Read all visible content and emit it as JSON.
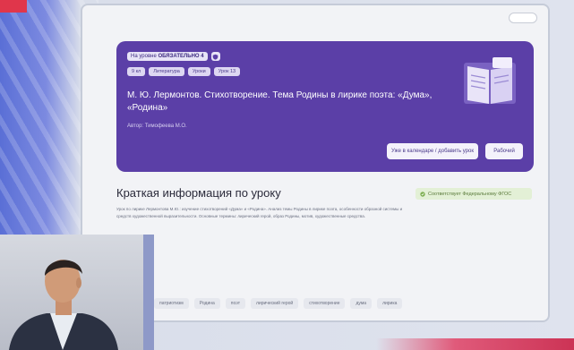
{
  "hero": {
    "tag_prefix": "На уровне",
    "tag_grade": "ОБЯЗАТЕЛЬНО 4",
    "chips": [
      "9 кл",
      "Литература",
      "Уроки",
      "Урок 13"
    ],
    "title": "М. Ю. Лермонтов. Стихотворение. Тема Родины в лирике поэта: «Дума», «Родина»",
    "author": "Автор: Тимофеева М.О.",
    "add_button": "Уже в календаре / добавить урок",
    "journal_button": "Рабочий"
  },
  "info": {
    "title": "Краткая информация по уроку",
    "badge": "Соответствует Федеральному ФГОС",
    "text": "Урок по лирике Лермонтова М.Ю.: изучение стихотворений «Дума» и «Родина». Анализ темы Родины в лирике поэта, особенности образной системы и средств художественной выразительности. Основные термины: лирический герой, образ Родины, мотив, художественные средства."
  },
  "keywords": [
    "патриотизм",
    "Родина",
    "поэт",
    "лирический герой",
    "стихотворение",
    "дума",
    "лирика"
  ],
  "colors": {
    "hero_bg": "#5b3fa7",
    "accent_badge": "#e3f0d6"
  }
}
